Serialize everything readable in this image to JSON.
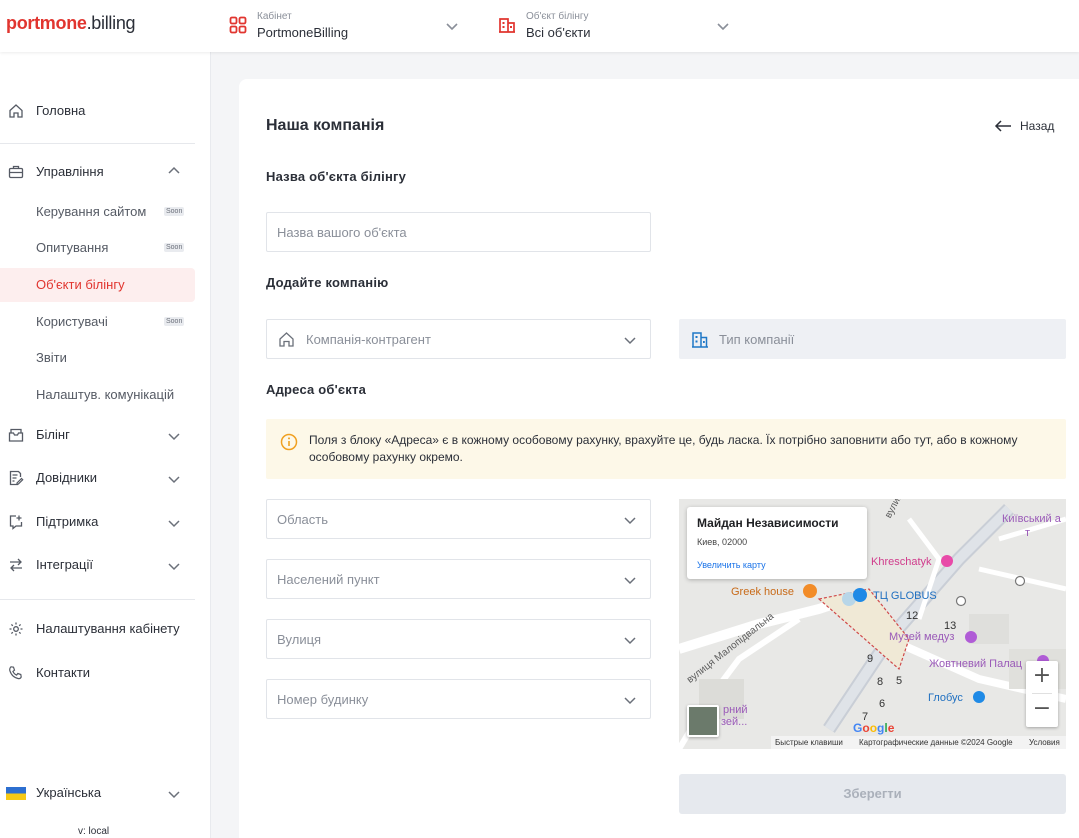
{
  "header": {
    "logo_red": "portmone",
    "logo_dark": ".billing",
    "cabinet": {
      "label": "Кабінет",
      "value": "PortmoneBilling"
    },
    "billing_object": {
      "label": "Об'єкт білінгу",
      "value": "Всі об'єкти"
    }
  },
  "sidebar": {
    "home": "Головна",
    "management": "Управління",
    "management_items": [
      {
        "label": "Керування сайтом",
        "badge": "Soon"
      },
      {
        "label": "Опитування",
        "badge": "Soon"
      },
      {
        "label": "Об'єкти білінгу",
        "badge": ""
      },
      {
        "label": "Користувачі",
        "badge": "Soon"
      },
      {
        "label": "Звіти",
        "badge": ""
      },
      {
        "label": "Налаштув. комунікацій",
        "badge": ""
      }
    ],
    "billing": "Білінг",
    "directories": "Довідники",
    "support": "Підтримка",
    "integrations": "Інтеграції",
    "cabinet_settings": "Налаштування кабінету",
    "contacts": "Контакти",
    "language": "Українська",
    "version": "v: local"
  },
  "main": {
    "title": "Наша компанія",
    "back_label": "Назад",
    "section_name": "Назва об'єкта білінгу",
    "name_placeholder": "Назва вашого об'єкта",
    "section_company": "Додайте компанію",
    "counterparty_placeholder": "Компанія-контрагент",
    "company_type_placeholder": "Тип компанії",
    "section_address": "Адреса об'єкта",
    "notice": "Поля з блоку «Адреса» є в кожному особовому рахунку, врахуйте це, будь ласка. Їх потрібно заповнити або тут, або в кожному особовому рахунку окремо.",
    "region_placeholder": "Область",
    "city_placeholder": "Населений пункт",
    "street_placeholder": "Вулиця",
    "house_placeholder": "Номер будинку",
    "save_label": "Зберегти"
  },
  "map": {
    "place_title": "Майдан Независимости",
    "place_address": "Киев, 02000",
    "enlarge_link": "Увеличить карту",
    "labels": {
      "kyiv": "Київський а",
      "kyiv2": "т",
      "khreschatyk": "Khreschatyk",
      "greek_house": "Greek house",
      "tc_globus": "ТЦ GLOBUS",
      "museum": "Музей медуз",
      "october_palace": "Жовтневий Палац",
      "globus": "Глобус",
      "street_kost": "вулиця Кост",
      "street_malopid": "вулиця Малопідвальна",
      "n12": "12",
      "n13": "13",
      "n9": "9",
      "n8": "8",
      "n5": "5",
      "n6": "6",
      "n7": "7",
      "partial": "рний",
      "partial2": "зей..."
    },
    "zoom_in": "+",
    "zoom_out": "−",
    "google": "Google",
    "shortcuts": "Быстрые клавиши",
    "map_data": "Картографические данные ©2024 Google",
    "terms": "Условия"
  },
  "colors": {
    "brand": "#e1352f",
    "active_bg": "#fdeeee",
    "notice_bg": "#fdf8e8"
  }
}
